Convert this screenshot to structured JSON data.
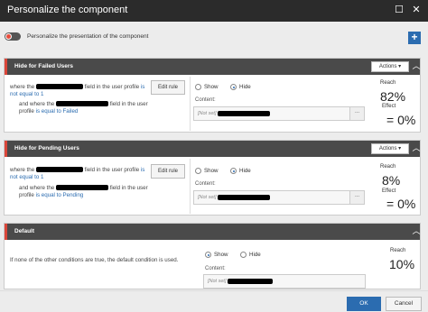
{
  "window": {
    "title": "Personalize the component",
    "restore_glyph": "☐",
    "close_glyph": "✕"
  },
  "toolbar": {
    "toggle_label": "Personalize the presentation of the component",
    "add_glyph": "+"
  },
  "sections": [
    {
      "name": "Hide for Failed Users",
      "actions_label": "Actions ▾",
      "collapse_glyph": "︿",
      "cond1_prefix": "where the",
      "cond1_mid": "field in the user profile",
      "cond1_op": "is not equal to 1",
      "cond2_prefix": "and where the",
      "cond2_mid": "field in the user profile",
      "cond2_op": "is equal to Failed",
      "edit_label": "Edit rule",
      "show_label": "Show",
      "hide_label": "Hide",
      "selected": "hide",
      "content_label": "Content:",
      "content_placeholder": "[Not set]",
      "reach_label": "Reach",
      "reach_value": "82%",
      "effect_label": "Effect",
      "effect_value": "= 0%"
    },
    {
      "name": "Hide for Pending Users",
      "actions_label": "Actions ▾",
      "collapse_glyph": "︿",
      "cond1_prefix": "where the",
      "cond1_mid": "field in the user profile",
      "cond1_op": "is not equal to 1",
      "cond2_prefix": "and where the",
      "cond2_mid": "field in the user profile",
      "cond2_op": "is equal to Pending",
      "edit_label": "Edit rule",
      "show_label": "Show",
      "hide_label": "Hide",
      "selected": "hide",
      "content_label": "Content:",
      "content_placeholder": "[Not set]",
      "reach_label": "Reach",
      "reach_value": "8%",
      "effect_label": "Effect",
      "effect_value": "= 0%"
    },
    {
      "name": "Default",
      "actions_label": "",
      "collapse_glyph": "︿",
      "default_text": "If none of the other conditions are true, the default condition is used.",
      "show_label": "Show",
      "hide_label": "Hide",
      "selected": "show",
      "content_label": "Content:",
      "content_placeholder": "[Not set]",
      "reach_label": "Reach",
      "reach_value": "10%"
    }
  ],
  "footer": {
    "ok_label": "OK",
    "cancel_label": "Cancel"
  },
  "colors": {
    "accent": "#2b6cb0",
    "section_marker": "#d9463a",
    "header_bg": "#4a4a4a"
  }
}
